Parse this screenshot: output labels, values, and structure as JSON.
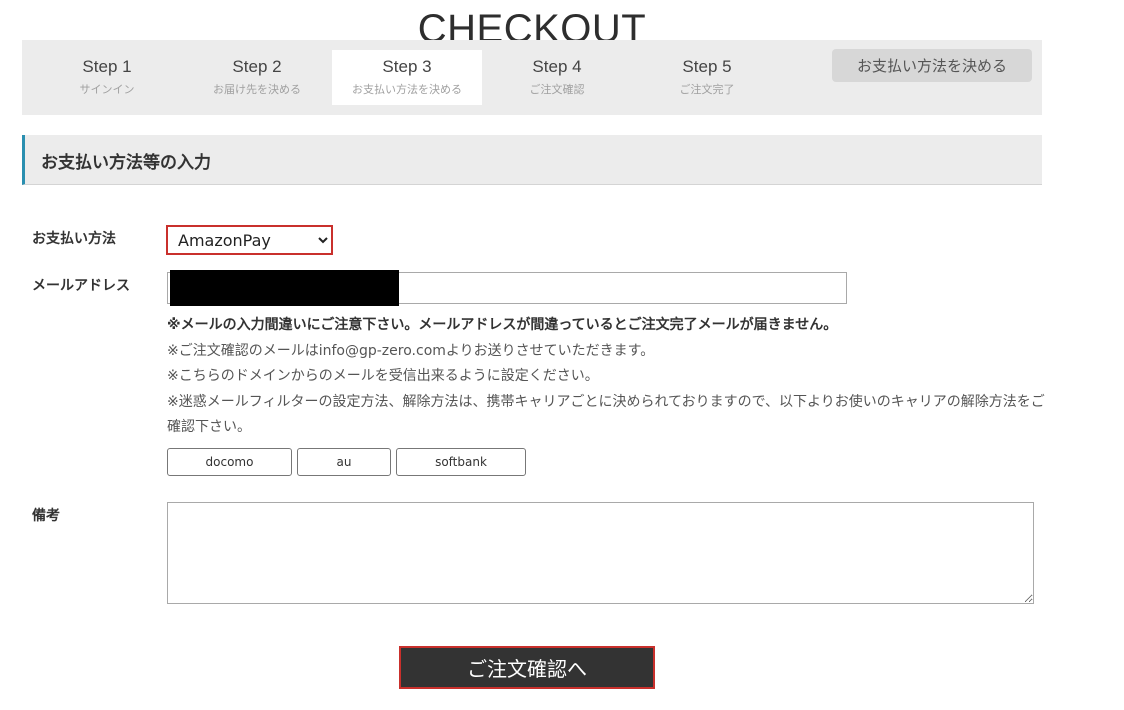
{
  "page_title": "CHECKOUT",
  "steps": [
    {
      "label": "Step 1",
      "sub": "サインイン"
    },
    {
      "label": "Step 2",
      "sub": "お届け先を決める"
    },
    {
      "label": "Step 3",
      "sub": "お支払い方法を決める"
    },
    {
      "label": "Step 4",
      "sub": "ご注文確認"
    },
    {
      "label": "Step 5",
      "sub": "ご注文完了"
    }
  ],
  "active_step": 3,
  "current_step_button": "お支払い方法を決める",
  "section_title": "お支払い方法等の入力",
  "payment": {
    "label": "お支払い方法",
    "selected": "AmazonPay"
  },
  "email": {
    "label": "メールアドレス",
    "value": ""
  },
  "notes": {
    "warning": "※メールの入力間違いにご注意下さい。メールアドレスが間違っているとご注文完了メールが届きません。",
    "sender": "※ご注文確認のメールはinfo@gp-zero.comよりお送りさせていただきます。",
    "domain": "※こちらのドメインからのメールを受信出来るように設定ください。",
    "filter": "※迷惑メールフィルターの設定方法、解除方法は、携帯キャリアごとに決められておりますので、以下よりお使いのキャリアの解除方法をご確認下さい。"
  },
  "carriers": [
    "docomo",
    "au",
    "softbank"
  ],
  "remarks": {
    "label": "備考",
    "value": ""
  },
  "submit_label": "ご注文確認へ",
  "colors": {
    "accent_red": "#c9302c",
    "section_border": "#2a8fb0",
    "bar_bg": "#ececec",
    "submit_bg": "#333333"
  }
}
